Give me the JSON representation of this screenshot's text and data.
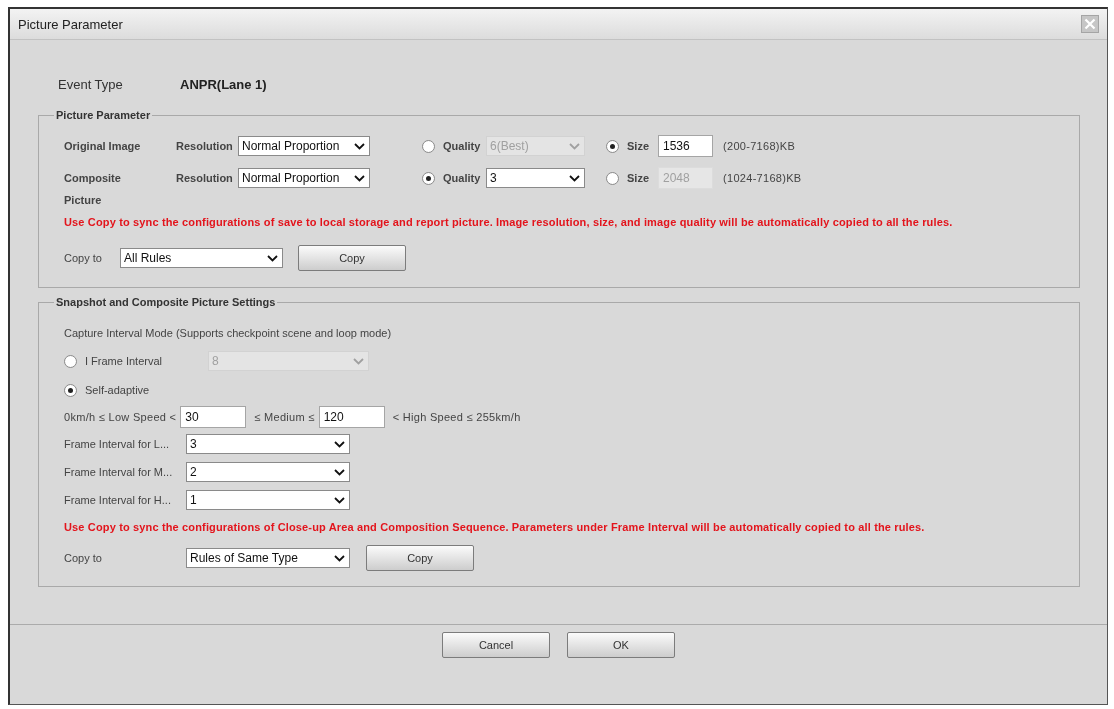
{
  "window": {
    "title": "Picture Parameter"
  },
  "event_type": {
    "label": "Event Type",
    "value": "ANPR(Lane 1)"
  },
  "picture_parameter": {
    "legend": "Picture Parameter",
    "rows": [
      {
        "label": "Original Image",
        "resolution_label": "Resolution",
        "resolution": "Normal Proportion",
        "options": [
          {
            "kind": "quality",
            "label": "Quality",
            "value": "6(Best)",
            "selected": false
          },
          {
            "kind": "size",
            "label": "Size",
            "value": "1536",
            "range": "(200-7168)KB",
            "selected": true
          }
        ]
      },
      {
        "label": "Composite Picture",
        "resolution_label": "Resolution",
        "resolution": "Normal Proportion",
        "options": [
          {
            "kind": "quality",
            "label": "Quality",
            "value": "3",
            "selected": true
          },
          {
            "kind": "size",
            "label": "Size",
            "value": "2048",
            "range": "(1024-7168)KB",
            "selected": false
          }
        ]
      }
    ],
    "note": "Use Copy to sync the configurations of save to local storage and report picture. Image resolution, size, and image quality will be automatically copied to all the rules.",
    "copy_to": {
      "label": "Copy to",
      "value": "All Rules",
      "button": "Copy"
    }
  },
  "snapshot_settings": {
    "legend": "Snapshot and Composite Picture Settings",
    "mode_title": "Capture Interval Mode (Supports checkpoint scene and loop mode)",
    "modes": [
      {
        "label": "I Frame Interval",
        "value": "8",
        "selected": false
      },
      {
        "label": "Self-adaptive",
        "selected": true
      }
    ],
    "speed": [
      {
        "kind": "text",
        "text": "0km/h ≤ Low Speed <"
      },
      {
        "kind": "input",
        "value": "30"
      },
      {
        "kind": "text",
        "text": "≤ Medium ≤"
      },
      {
        "kind": "input",
        "value": "120"
      },
      {
        "kind": "text",
        "text": "< High Speed ≤ 255km/h"
      }
    ],
    "frame_intervals": [
      {
        "label": "Frame Interval for L...",
        "value": "3"
      },
      {
        "label": "Frame Interval for M...",
        "value": "2"
      },
      {
        "label": "Frame Interval for H...",
        "value": "1"
      }
    ],
    "note": "Use Copy to sync the configurations of Close-up Area and Composition Sequence. Parameters under Frame Interval will be automatically copied to all the rules.",
    "copy_to": {
      "label": "Copy to",
      "value": "Rules of Same Type",
      "button": "Copy"
    }
  },
  "buttons": [
    "Cancel",
    "OK"
  ]
}
